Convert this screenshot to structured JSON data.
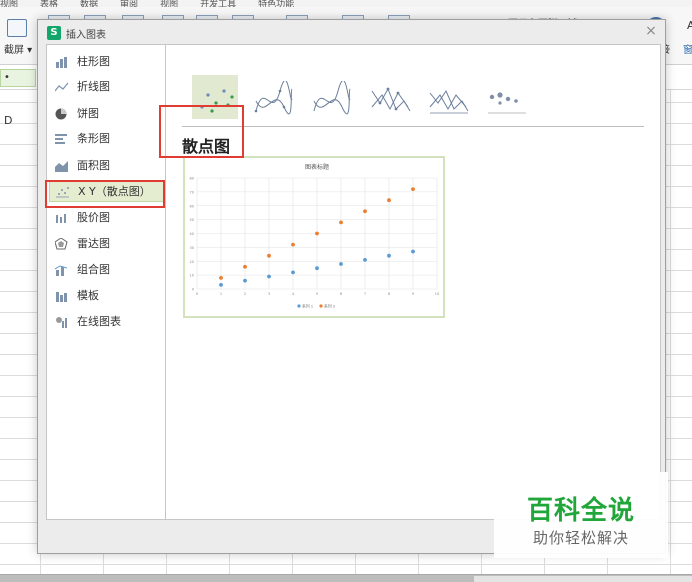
{
  "background": {
    "menu_items": [
      "视图",
      "表格",
      "数据",
      "审阅",
      "视图",
      "开发工具",
      "特色功能"
    ],
    "screenshot_label": "截屏 ▾",
    "ribbon_right_text": "页眉和页脚  对象",
    "right_text_1": "A",
    "right_text_2": "接",
    "right_text_3": "窗",
    "cell_ref": "•",
    "column_header": "D"
  },
  "dialog": {
    "title": "插入图表",
    "logo": "S",
    "close_glyph": "×",
    "chart_types": [
      {
        "label": "柱形图",
        "icon": "column-chart-icon"
      },
      {
        "label": "折线图",
        "icon": "line-chart-icon"
      },
      {
        "label": "饼图",
        "icon": "pie-chart-icon"
      },
      {
        "label": "条形图",
        "icon": "bar-chart-icon"
      },
      {
        "label": "面积图",
        "icon": "area-chart-icon"
      },
      {
        "label": "X Y（散点图）",
        "icon": "scatter-chart-icon",
        "selected": true
      },
      {
        "label": "股价图",
        "icon": "stock-chart-icon"
      },
      {
        "label": "雷达图",
        "icon": "radar-chart-icon"
      },
      {
        "label": "组合图",
        "icon": "combo-chart-icon"
      },
      {
        "label": "模板",
        "icon": "template-icon"
      },
      {
        "label": "在线图表",
        "icon": "online-chart-icon"
      }
    ],
    "subtypes": [
      {
        "name": "scatter-markers-only",
        "selected": true
      },
      {
        "name": "scatter-smooth-lines-markers"
      },
      {
        "name": "scatter-smooth-lines"
      },
      {
        "name": "scatter-straight-lines-markers"
      },
      {
        "name": "scatter-straight-lines"
      },
      {
        "name": "bubble"
      }
    ],
    "section_title": "散点图"
  },
  "colors": {
    "accent_green": "#12a66a",
    "selected_bg": "#e4edcf",
    "annotation_red": "#e03c31",
    "series_orange": "#ed7d31",
    "series_blue": "#5b9bd5",
    "watermark_green": "#21a63a"
  },
  "chart_data": {
    "type": "scatter",
    "title": "图表标题",
    "x": [
      1,
      2,
      3,
      4,
      5,
      6,
      7,
      8,
      9
    ],
    "series": [
      {
        "name": "系列 1",
        "color": "#5b9bd5",
        "values": [
          3,
          6,
          9,
          12,
          15,
          18,
          21,
          24,
          27
        ]
      },
      {
        "name": "系列 2",
        "color": "#ed7d31",
        "values": [
          8,
          16,
          24,
          32,
          40,
          48,
          56,
          64,
          72
        ]
      }
    ],
    "xlim": [
      0,
      10
    ],
    "ylim": [
      0,
      80
    ],
    "yticks": [
      0,
      10,
      20,
      30,
      40,
      50,
      60,
      70,
      80
    ],
    "xticks": [
      0,
      1,
      2,
      3,
      4,
      5,
      6,
      7,
      8,
      9,
      10
    ],
    "grid": true,
    "legend": "bottom"
  },
  "watermark": {
    "title": "百科全说",
    "subtitle": "助你轻松解决"
  }
}
